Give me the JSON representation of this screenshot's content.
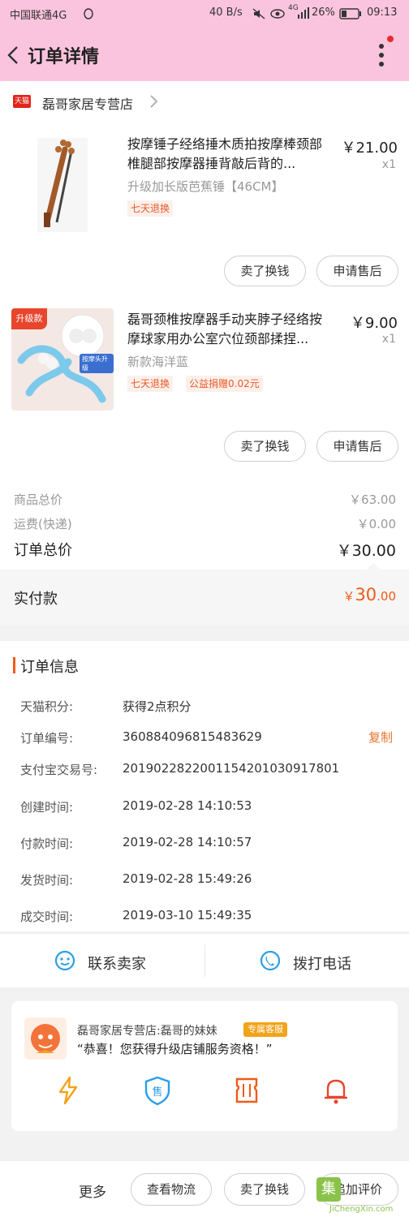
{
  "status_bar": {
    "carrier": "中国联通4G",
    "speed": "40 B/s",
    "signal": "4G",
    "battery": "26%",
    "time": "09:13"
  },
  "header": {
    "title": "订单详情",
    "back_icon": "chevron-left-icon",
    "menu_icon": "more-vertical-icon"
  },
  "shop": {
    "badge": "天猫",
    "name": "磊哥家居专营店"
  },
  "products": [
    {
      "title": "按摩锤子经络捶木质拍按摩棒颈部椎腿部按摩器捶背敲后背的...",
      "price": "￥21.00",
      "qty": "x1",
      "sku": "升级加长版芭蕉锤【46CM】",
      "tags": [
        "七天退换"
      ],
      "buttons": [
        "卖了换钱",
        "申请售后"
      ]
    },
    {
      "badge": "升级款",
      "image_text": "按摩头升级",
      "title": "磊哥颈椎按摩器手动夹脖子经络按摩球家用办公室穴位颈部揉捏...",
      "price": "￥9.00",
      "qty": "x1",
      "sku": "新款海洋蓝",
      "tags": [
        "七天退换",
        "公益捐赠0.02元"
      ],
      "buttons": [
        "卖了换钱",
        "申请售后"
      ]
    }
  ],
  "summary": {
    "goods_total_label": "商品总价",
    "goods_total": "￥63.00",
    "shipping_label": "运费(快递)",
    "shipping": "￥0.00",
    "order_total_label": "订单总价",
    "order_total": "￥30.00",
    "paid_label": "实付款",
    "paid_symbol": "￥",
    "paid_int": "30",
    "paid_dec": ".00"
  },
  "order_info": {
    "title": "订单信息",
    "copy_label": "复制",
    "rows": [
      {
        "label": "天猫积分:",
        "value": "获得2点积分"
      },
      {
        "label": "订单编号:",
        "value": "360884096815483629"
      },
      {
        "label": "支付宝交易号:",
        "value": "2019022822001154201030917801"
      },
      {
        "label": "创建时间:",
        "value": "2019-02-28 14:10:53"
      },
      {
        "label": "付款时间:",
        "value": "2019-02-28 14:10:57"
      },
      {
        "label": "发货时间:",
        "value": "2019-02-28 15:49:26"
      },
      {
        "label": "成交时间:",
        "value": "2019-03-10 15:49:35"
      }
    ]
  },
  "actions": {
    "contact_seller": "联系卖家",
    "call_phone": "拨打电话"
  },
  "service_card": {
    "title": "磊哥家居专营店:磊哥的妹妹",
    "badge": "专属客服",
    "message": "“恭喜！您获得升级店铺服务资格！”",
    "icons": [
      "lightning-icon",
      "after-sale-shield-icon",
      "ticket-icon",
      "bell-icon"
    ],
    "after_sale_char": "售"
  },
  "bottom_bar": {
    "more": "更多",
    "buttons": [
      "查看物流",
      "卖了换钱",
      "追加评价"
    ],
    "watermark": "JiChengXin.com",
    "watermark_char": "集"
  },
  "colors": {
    "header_bg": "#fbc4de",
    "accent": "#f05a18",
    "tmall_red": "#e2231a",
    "icon_blue": "#2a9ee8"
  }
}
